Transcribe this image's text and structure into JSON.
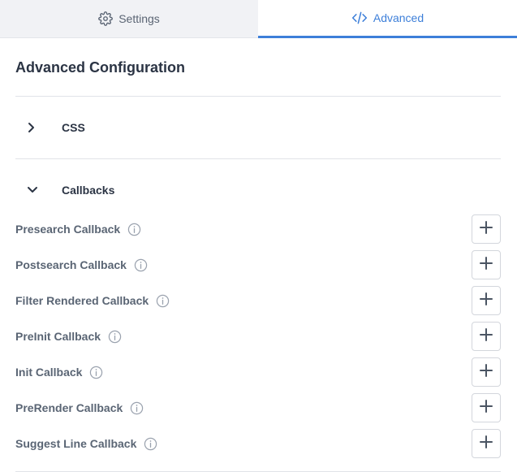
{
  "tabs": {
    "settings_label": "Settings",
    "advanced_label": "Advanced",
    "active": "Advanced"
  },
  "page": {
    "title": "Advanced Configuration"
  },
  "sections": {
    "css_label": "CSS",
    "callbacks_label": "Callbacks"
  },
  "callbacks": [
    {
      "label": "Presearch Callback"
    },
    {
      "label": "Postsearch Callback"
    },
    {
      "label": "Filter Rendered Callback"
    },
    {
      "label": "PreInit Callback"
    },
    {
      "label": "Init Callback"
    },
    {
      "label": "PreRender Callback"
    },
    {
      "label": "Suggest Line Callback"
    }
  ],
  "icons": {
    "settings_tab": "gear-icon",
    "advanced_tab": "code-icon",
    "css_toggle": "chevron-right-icon",
    "callbacks_toggle": "chevron-down-icon",
    "callback_info": "info-icon",
    "callback_add": "plus-icon"
  },
  "colors": {
    "accent": "#3d7fd9",
    "inactive_tab_bg": "#f1f2f5",
    "text_dark": "#2b3444",
    "text_muted": "#5a6574",
    "divider": "#e1e3e8"
  }
}
